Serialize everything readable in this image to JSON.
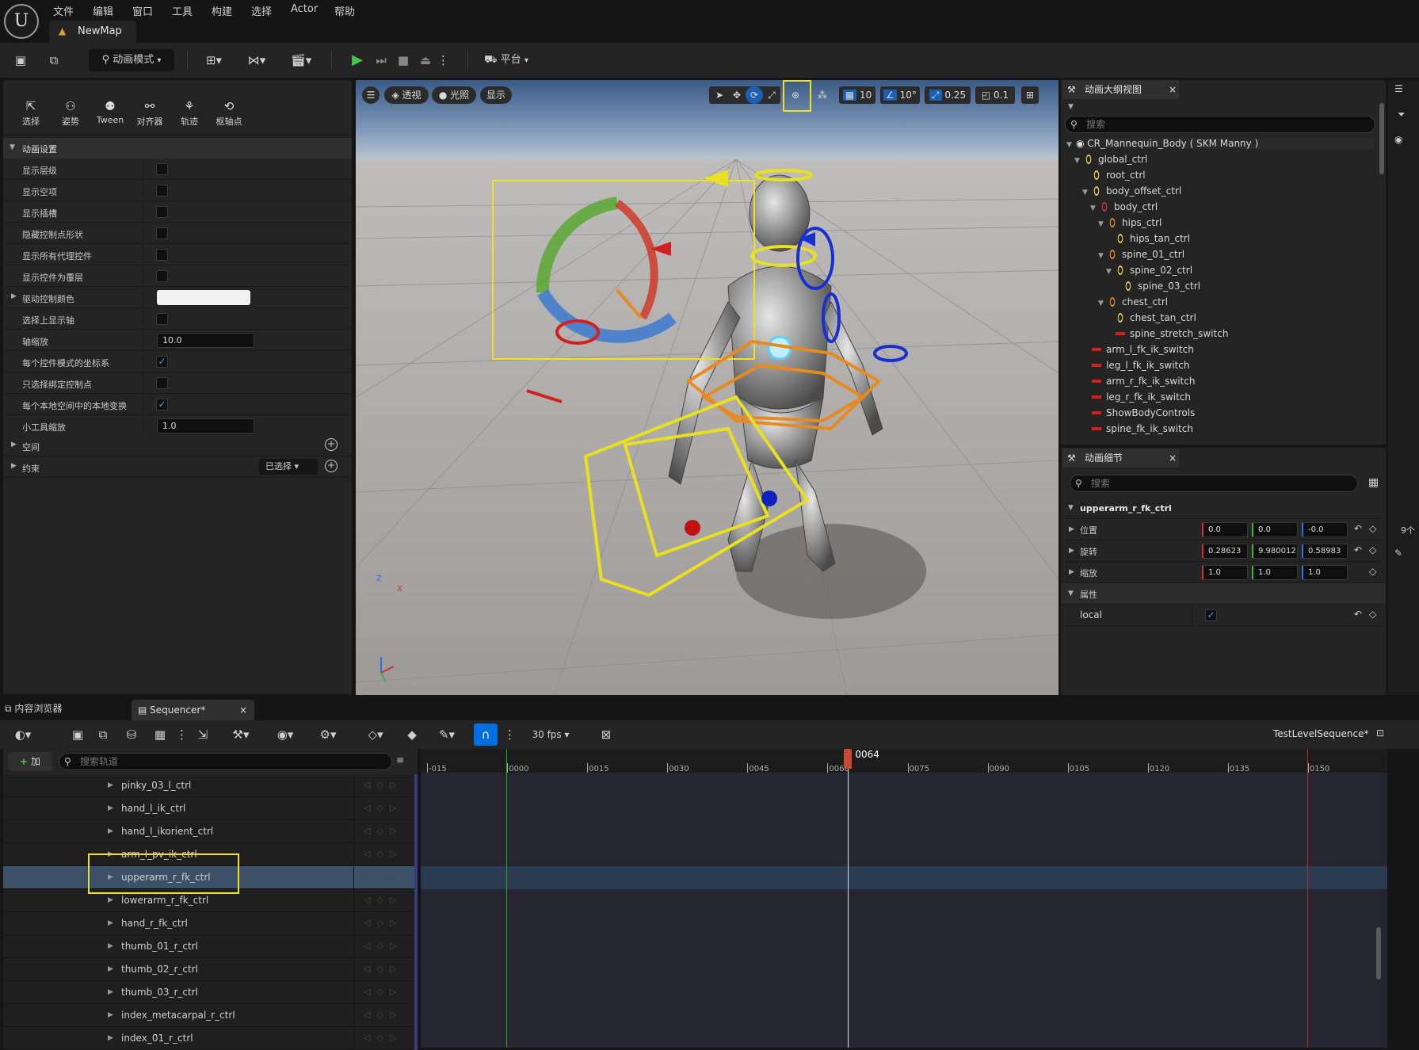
{
  "menu": [
    "文件",
    "编辑",
    "窗口",
    "工具",
    "构建",
    "选择",
    "Actor",
    "帮助"
  ],
  "map_tab": "NewMap",
  "toolbar": {
    "mode_combo": "动画模式",
    "platform": "平台"
  },
  "modes": [
    "选择",
    "姿势",
    "Tween",
    "对齐器",
    "轨迹",
    "枢轴点"
  ],
  "anim_settings": {
    "section": "动画设置",
    "rows": [
      {
        "label": "显示层级",
        "type": "check",
        "checked": false
      },
      {
        "label": "显示空项",
        "type": "check",
        "checked": false
      },
      {
        "label": "显示插槽",
        "type": "check",
        "checked": false
      },
      {
        "label": "隐藏控制点形状",
        "type": "check",
        "checked": false
      },
      {
        "label": "显示所有代理控件",
        "type": "check",
        "checked": false
      },
      {
        "label": "显示控件为覆层",
        "type": "check",
        "checked": false
      },
      {
        "label": "驱动控制颜色",
        "type": "color",
        "expand": true
      },
      {
        "label": "选择上显示轴",
        "type": "check",
        "checked": false
      },
      {
        "label": "轴缩放",
        "type": "num",
        "value": "10.0"
      },
      {
        "label": "每个控件模式的坐标系",
        "type": "check",
        "checked": true
      },
      {
        "label": "只选择绑定控制点",
        "type": "check",
        "checked": false
      },
      {
        "label": "每个本地空间中的本地变换",
        "type": "check",
        "checked": true
      },
      {
        "label": "小工具缩放",
        "type": "num",
        "value": "1.0"
      }
    ],
    "space": "空间",
    "constraints": "约束",
    "constraint_combo": "已选择"
  },
  "viewport": {
    "perspective": "透视",
    "lit": "光照",
    "show": "显示",
    "grid_snap": "10",
    "angle_snap": "10°",
    "scale_snap": "0.25",
    "camera_speed": "0.1",
    "axis_z": "Z",
    "axis_x": "X"
  },
  "outliner": {
    "title": "动画大纲视图",
    "search": "搜索",
    "items": [
      {
        "label": "CR_Mannequin_Body ( SKM Manny )",
        "depth": 0,
        "icon": "eye",
        "arrow": true
      },
      {
        "label": "global_ctrl",
        "depth": 1,
        "icon": "yellow",
        "arrow": true
      },
      {
        "label": "root_ctrl",
        "depth": 2,
        "icon": "yellow",
        "arrow": false
      },
      {
        "label": "body_offset_ctrl",
        "depth": 2,
        "icon": "yellow",
        "arrow": true
      },
      {
        "label": "body_ctrl",
        "depth": 3,
        "icon": "red",
        "arrow": true
      },
      {
        "label": "hips_ctrl",
        "depth": 4,
        "icon": "orange",
        "arrow": true
      },
      {
        "label": "hips_tan_ctrl",
        "depth": 5,
        "icon": "yellow",
        "arrow": false
      },
      {
        "label": "spine_01_ctrl",
        "depth": 4,
        "icon": "orange",
        "arrow": true
      },
      {
        "label": "spine_02_ctrl",
        "depth": 5,
        "icon": "yellow",
        "arrow": true
      },
      {
        "label": "spine_03_ctrl",
        "depth": 6,
        "icon": "yellow",
        "arrow": false
      },
      {
        "label": "chest_ctrl",
        "depth": 4,
        "icon": "orange",
        "arrow": true
      },
      {
        "label": "chest_tan_ctrl",
        "depth": 5,
        "icon": "yellow",
        "arrow": false
      },
      {
        "label": "spine_stretch_switch",
        "depth": 5,
        "icon": "bar",
        "arrow": false
      },
      {
        "label": "arm_l_fk_ik_switch",
        "depth": 2,
        "icon": "bar",
        "arrow": false
      },
      {
        "label": "leg_l_fk_ik_switch",
        "depth": 2,
        "icon": "bar",
        "arrow": false
      },
      {
        "label": "arm_r_fk_ik_switch",
        "depth": 2,
        "icon": "bar",
        "arrow": false
      },
      {
        "label": "leg_r_fk_ik_switch",
        "depth": 2,
        "icon": "bar",
        "arrow": false
      },
      {
        "label": "ShowBodyControls",
        "depth": 2,
        "icon": "bar",
        "arrow": false
      },
      {
        "label": "spine_fk_ik_switch",
        "depth": 2,
        "icon": "bar",
        "arrow": false
      }
    ]
  },
  "details": {
    "title": "动画细节",
    "search": "搜索",
    "control": "upperarm_r_fk_ctrl",
    "location_label": "位置",
    "location": [
      "0.0",
      "0.0",
      "-0.0"
    ],
    "rotation_label": "旋转",
    "rotation": [
      "0.28623",
      "9.980012",
      "0.58983"
    ],
    "scale_label": "缩放",
    "scale": [
      "1.0",
      "1.0",
      "1.0"
    ],
    "attributes": "属性",
    "local_label": "local",
    "local_checked": true
  },
  "right_edge": {
    "count": "9个"
  },
  "bottom_tabs": {
    "content_browser": "内容浏览器",
    "sequencer": "Sequencer*"
  },
  "sequencer": {
    "fps": "30 fps",
    "sequence_name": "TestLevelSequence*",
    "add_button": "加",
    "search_placeholder": "搜索轨道",
    "playhead": "0064",
    "playhead_frame": 64,
    "range_start": 0,
    "range_end": 150,
    "view_start": -15,
    "view_end": 165,
    "ticks": [
      "-015",
      "0000",
      "0015",
      "0030",
      "0045",
      "0060",
      "0075",
      "0090",
      "0105",
      "0120",
      "0135",
      "0150"
    ],
    "tracks": [
      {
        "name": "pinky_03_l_ctrl",
        "selected": false
      },
      {
        "name": "hand_l_ik_ctrl",
        "selected": false
      },
      {
        "name": "hand_l_ikorient_ctrl",
        "selected": false
      },
      {
        "name": "arm_l_pv_ik_ctrl",
        "selected": false
      },
      {
        "name": "upperarm_r_fk_ctrl",
        "selected": true
      },
      {
        "name": "lowerarm_r_fk_ctrl",
        "selected": false
      },
      {
        "name": "hand_r_fk_ctrl",
        "selected": false
      },
      {
        "name": "thumb_01_r_ctrl",
        "selected": false
      },
      {
        "name": "thumb_02_r_ctrl",
        "selected": false
      },
      {
        "name": "thumb_03_r_ctrl",
        "selected": false
      },
      {
        "name": "index_metacarpal_r_ctrl",
        "selected": false
      },
      {
        "name": "index_01_r_ctrl",
        "selected": false
      }
    ]
  },
  "colors": {
    "accent": "#0070e0",
    "highlight_box": "#f0e020",
    "selection": "#3c5068",
    "panel": "#242424"
  }
}
